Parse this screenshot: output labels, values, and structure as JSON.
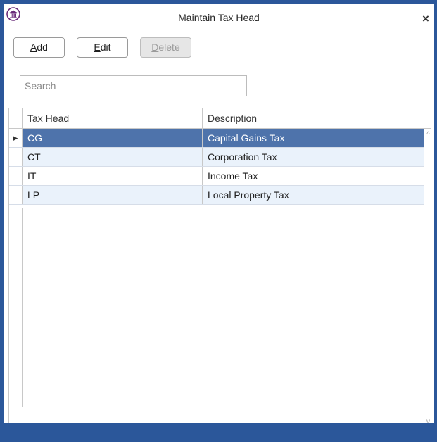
{
  "window": {
    "title": "Maintain Tax Head",
    "close_glyph": "×",
    "app_icon": "building-icon"
  },
  "toolbar": {
    "add_label_accel": "A",
    "add_label_rest": "dd",
    "edit_label_accel": "E",
    "edit_label_rest": "dit",
    "delete_label_accel": "D",
    "delete_label_rest": "elete"
  },
  "search": {
    "placeholder": "Search",
    "value": ""
  },
  "grid": {
    "columns": [
      "Tax Head",
      "Description"
    ],
    "current_row_glyph": "▶",
    "rows": [
      {
        "tax_head": "CG",
        "description": "Capital Gains Tax",
        "selected": true
      },
      {
        "tax_head": "CT",
        "description": "Corporation Tax",
        "selected": false
      },
      {
        "tax_head": "IT",
        "description": "Income Tax",
        "selected": false
      },
      {
        "tax_head": "LP",
        "description": "Local Property Tax",
        "selected": false
      }
    ],
    "scroll_up_glyph": "^",
    "scroll_down_glyph": "v"
  },
  "colors": {
    "accent": "#2b579a",
    "selection": "#4e73ab",
    "alt_row": "#eaf2fb"
  }
}
